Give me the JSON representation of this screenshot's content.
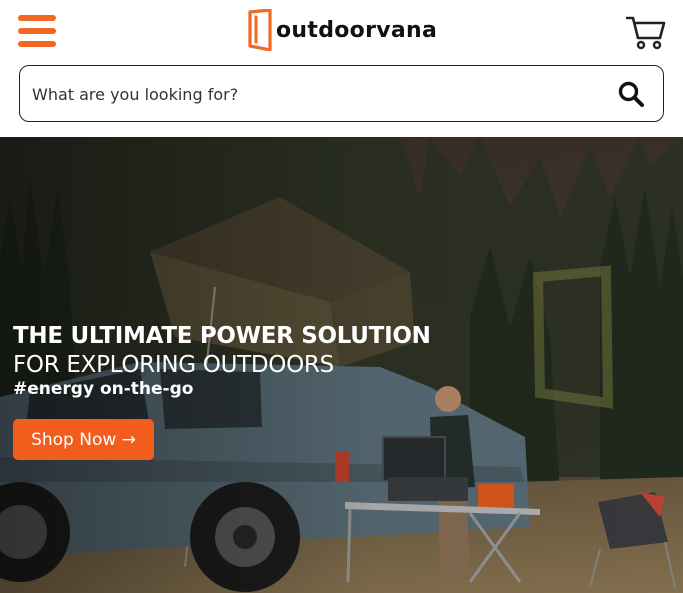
{
  "header": {
    "brand": "outdoorvana",
    "menu_icon": "hamburger-menu-icon",
    "cart_icon": "shopping-cart-icon"
  },
  "search": {
    "placeholder": "What are you looking for?",
    "value": "",
    "icon": "search-icon"
  },
  "hero": {
    "title_line1": "THE ULTIMATE POWER SOLUTION",
    "title_line2": "FOR EXPLORING OUTDOORS",
    "tagline": "#energy on-the-go",
    "cta_label": "Shop Now →"
  },
  "colors": {
    "accent": "#f26722",
    "cta": "#f25c1d",
    "text_dark": "#111111"
  }
}
